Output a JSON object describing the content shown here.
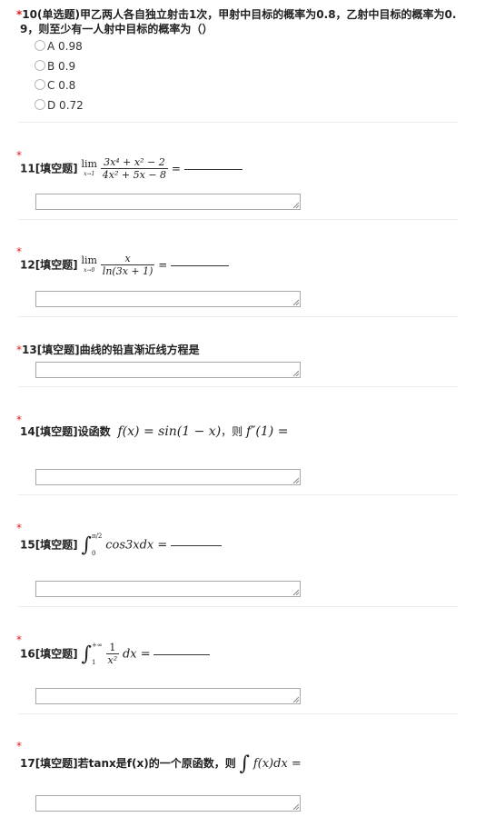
{
  "q10": {
    "star": "*",
    "title_line1": "10(单选题)甲乙两人各自独立射击1次，甲射中目标的概率为0.8，乙射中目标的概率为0.",
    "title_line2": "9，则至少有一人射中目标的概率为（）",
    "options": [
      "A 0.98",
      "B 0.9",
      "C 0.8",
      "D 0.72"
    ]
  },
  "q11": {
    "star": "*",
    "label": "11[填空题]",
    "lim_word": "lim",
    "lim_sub": "x→1",
    "num": "3x⁴ + x² − 2",
    "den": "4x² + 5x − 8",
    "eq": "="
  },
  "q12": {
    "star": "*",
    "label": "12[填空题]",
    "lim_word": "lim",
    "lim_sub": "x→0",
    "num": "x",
    "den": "ln(3x + 1)",
    "eq": "="
  },
  "q13": {
    "star": "*",
    "label": "13[填空题]曲线的铅直渐近线方程是"
  },
  "q14": {
    "star": "*",
    "label": "14[填空题]设函数",
    "expr": "f(x) = sin(1 − x)",
    "then": "，则",
    "expr2": "f″(1) ="
  },
  "q15": {
    "star": "*",
    "label": "15[填空题]",
    "integral": "∫",
    "upper": "π/2",
    "lower": "0",
    "expr": "cos3xdx ="
  },
  "q16": {
    "star": "*",
    "label": "16[填空题]",
    "integral": "∫",
    "upper": "+∞",
    "lower": "1",
    "num": "1",
    "den": "x²",
    "dx": "dx ="
  },
  "q17": {
    "star": "*",
    "label": "17[填空题]若tanx是f(x)的一个原函数，则",
    "integral": "∫",
    "expr": "f(x)dx ="
  }
}
